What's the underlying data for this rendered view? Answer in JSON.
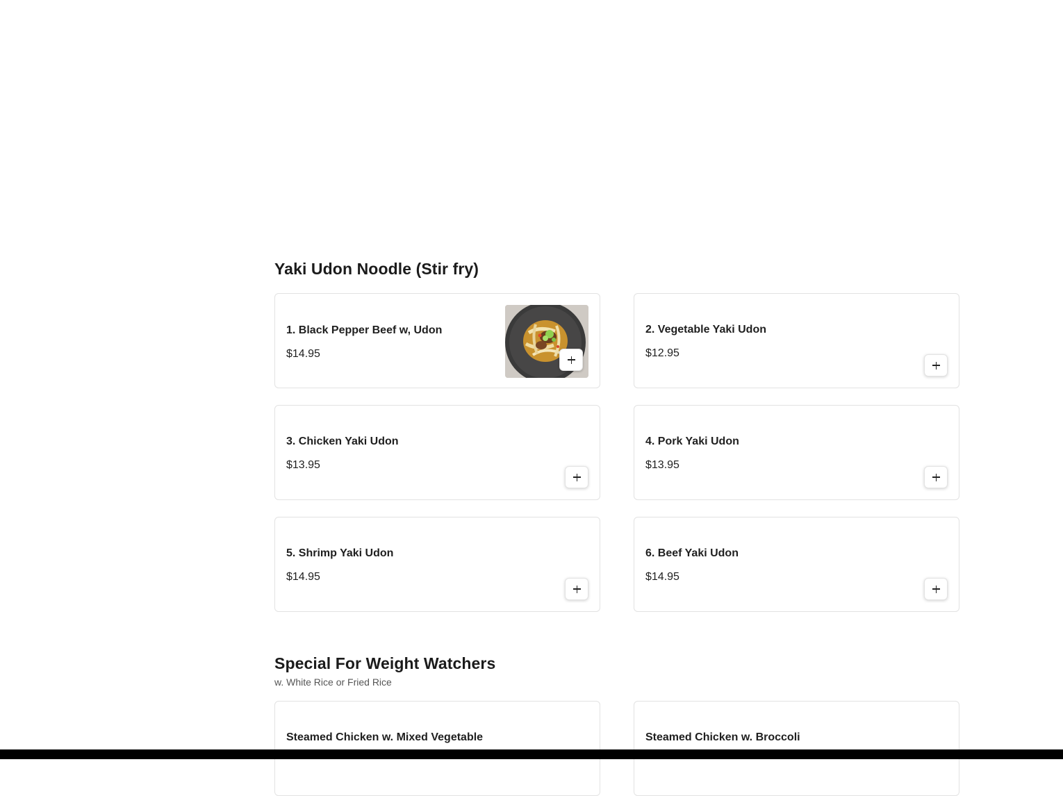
{
  "sections": [
    {
      "title": "Yaki Udon Noodle (Stir fry)",
      "items": [
        {
          "name": "1. Black Pepper Beef w, Udon",
          "price": "$14.95",
          "image_alt": "Black pepper beef udon in a dark bowl"
        },
        {
          "name": "2. Vegetable Yaki Udon",
          "price": "$12.95"
        },
        {
          "name": "3. Chicken Yaki Udon",
          "price": "$13.95"
        },
        {
          "name": "4. Pork Yaki Udon",
          "price": "$13.95"
        },
        {
          "name": "5. Shrimp Yaki Udon",
          "price": "$14.95"
        },
        {
          "name": "6. Beef Yaki Udon",
          "price": "$14.95"
        }
      ]
    },
    {
      "title": "Special For Weight Watchers",
      "subtitle": "w. White Rice or Fried Rice",
      "items": [
        {
          "name": "Steamed Chicken w. Mixed Vegetable"
        },
        {
          "name": "Steamed Chicken w. Broccoli"
        }
      ]
    }
  ],
  "icons": {
    "add": "plus-icon"
  },
  "colors": {
    "text": "#1f1f1f",
    "card_border": "#e2e2e2",
    "background": "#ffffff"
  }
}
